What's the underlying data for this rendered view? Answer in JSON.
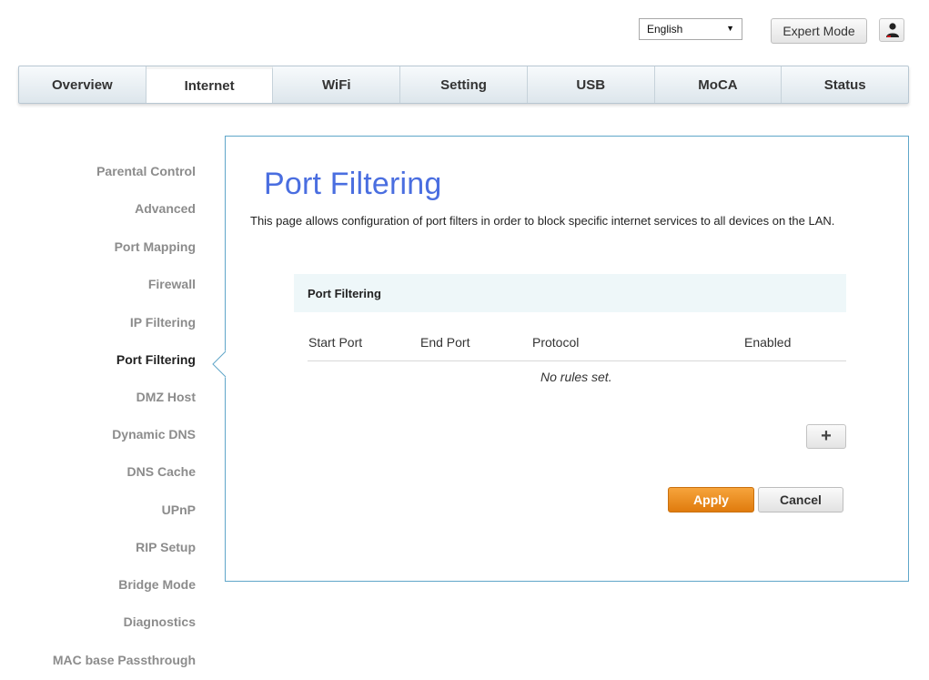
{
  "header": {
    "language_selected": "English",
    "expert_mode_label": "Expert Mode"
  },
  "nav": {
    "tabs": [
      {
        "label": "Overview",
        "active": false
      },
      {
        "label": "Internet",
        "active": true
      },
      {
        "label": "WiFi",
        "active": false
      },
      {
        "label": "Setting",
        "active": false
      },
      {
        "label": "USB",
        "active": false
      },
      {
        "label": "MoCA",
        "active": false
      },
      {
        "label": "Status",
        "active": false
      }
    ]
  },
  "sidebar": {
    "items": [
      {
        "label": "Parental Control",
        "active": false
      },
      {
        "label": "Advanced",
        "active": false
      },
      {
        "label": "Port Mapping",
        "active": false
      },
      {
        "label": "Firewall",
        "active": false
      },
      {
        "label": "IP Filtering",
        "active": false
      },
      {
        "label": "Port Filtering",
        "active": true
      },
      {
        "label": "DMZ Host",
        "active": false
      },
      {
        "label": "Dynamic DNS",
        "active": false
      },
      {
        "label": "DNS Cache",
        "active": false
      },
      {
        "label": "UPnP",
        "active": false
      },
      {
        "label": "RIP Setup",
        "active": false
      },
      {
        "label": "Bridge Mode",
        "active": false
      },
      {
        "label": "Diagnostics",
        "active": false
      },
      {
        "label": "MAC base Passthrough",
        "active": false
      }
    ]
  },
  "main": {
    "title": "Port Filtering",
    "description": "This page allows configuration of port filters in order to block specific internet services to all devices on the LAN.",
    "table": {
      "title": "Port Filtering",
      "columns": [
        "Start Port",
        "End Port",
        "Protocol",
        "Enabled"
      ],
      "empty_message": "No rules set."
    },
    "add_label": "+",
    "apply_label": "Apply",
    "cancel_label": "Cancel"
  },
  "colors": {
    "title_blue": "#4a6ee0",
    "panel_border": "#5fa6c9",
    "apply_orange": "#e88a1e",
    "table_header_bg": "#eef7f9"
  },
  "icons": {
    "user": "user-icon",
    "dropdown": "caret-down-icon",
    "add": "plus-icon"
  }
}
